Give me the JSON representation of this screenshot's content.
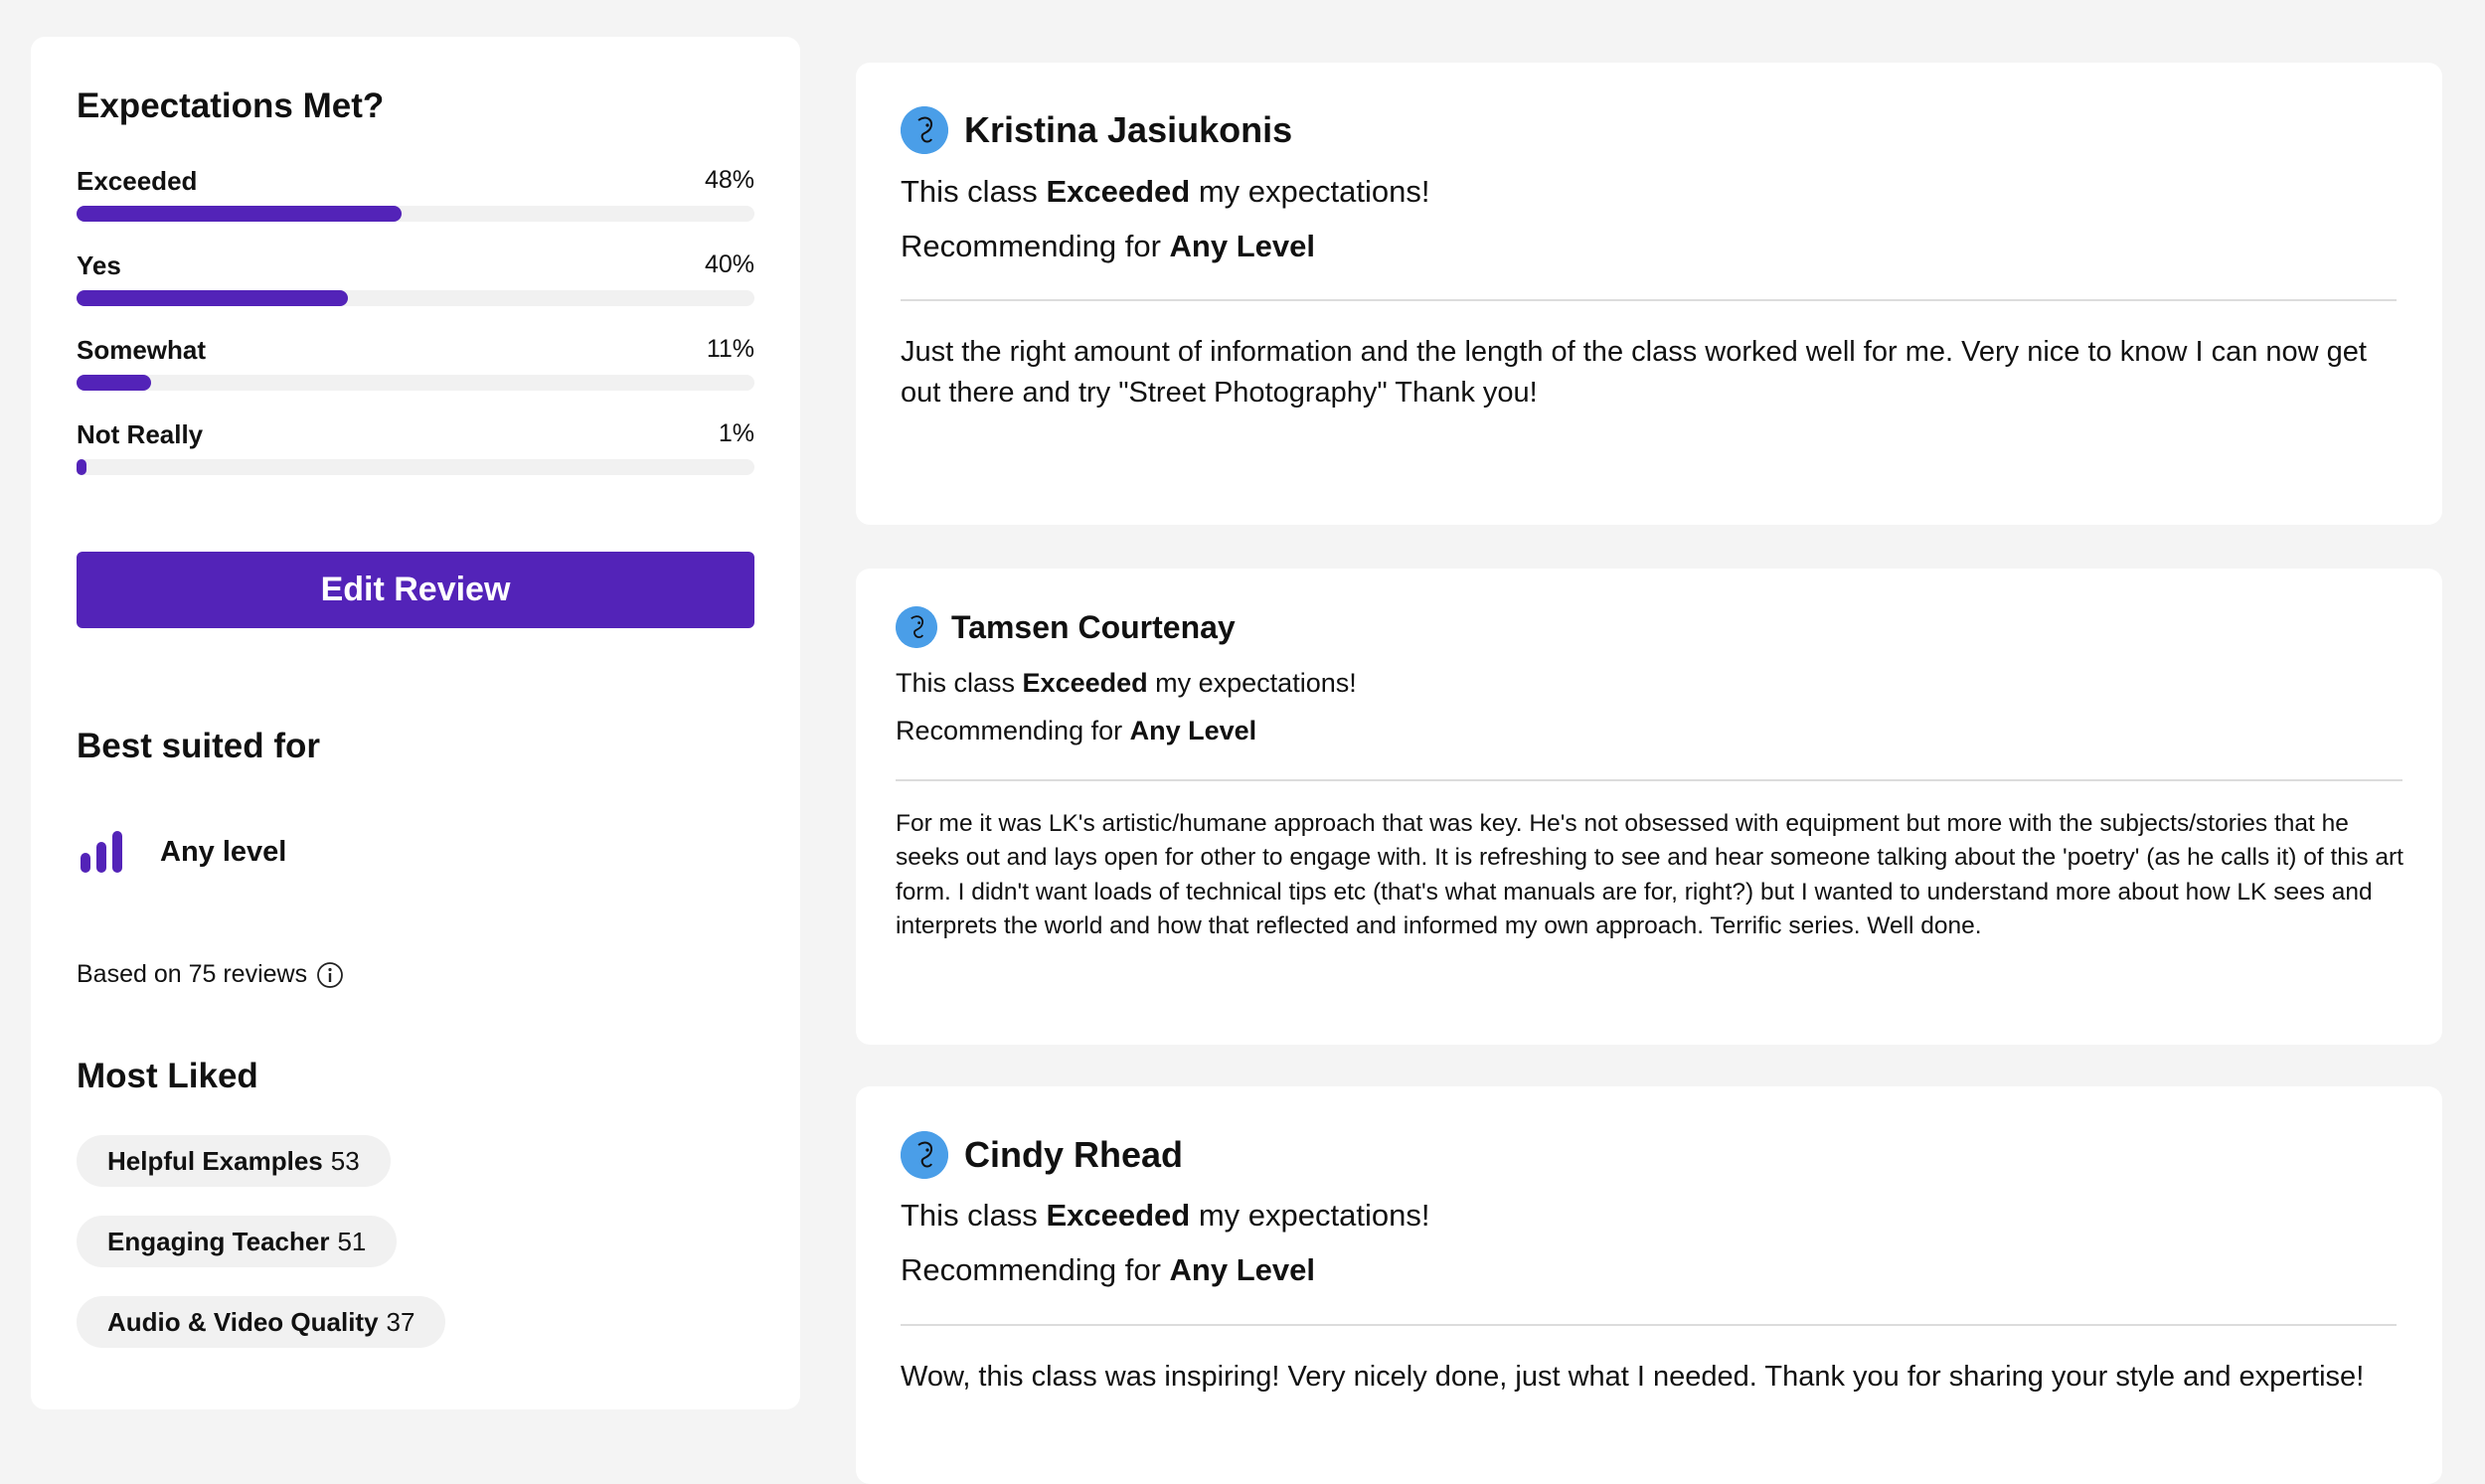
{
  "summary": {
    "expectations_title": "Expectations Met?",
    "bars": [
      {
        "label": "Exceeded",
        "pct_text": "48%",
        "fraction": 0.48
      },
      {
        "label": "Yes",
        "pct_text": "40%",
        "fraction": 0.4
      },
      {
        "label": "Somewhat",
        "pct_text": "11%",
        "fraction": 0.11
      },
      {
        "label": "Not Really",
        "pct_text": "1%",
        "fraction": 0.01
      }
    ],
    "edit_button_label": "Edit Review",
    "best_suited_title": "Best suited for",
    "level_label": "Any level",
    "based_on": "Based on 75 reviews",
    "most_liked_title": "Most Liked",
    "tags": [
      {
        "label": "Helpful Examples",
        "count": "53"
      },
      {
        "label": "Engaging Teacher",
        "count": "51"
      },
      {
        "label": "Audio & Video Quality",
        "count": "37"
      }
    ]
  },
  "reviews": [
    {
      "name": "Kristina Jasiukonis",
      "exp_prefix": "This class",
      "exp_value": "Exceeded",
      "exp_suffix": "my expectations!",
      "rec_prefix": "Recommending for",
      "rec_value": "Any Level",
      "text": "Just the right amount of information and the length of the class worked well for me. Very nice to know I can now get out there and try \"Street Photography\" Thank you!"
    },
    {
      "name": "Tamsen Courtenay",
      "exp_prefix": "This class",
      "exp_value": "Exceeded",
      "exp_suffix": "my expectations!",
      "rec_prefix": "Recommending for",
      "rec_value": "Any Level",
      "text": "For me it was LK's artistic/humane approach that was key. He's not obsessed with equipment but more with the subjects/stories that he seeks out and lays open for other to engage with. It is refreshing to see and hear someone talking about the 'poetry' (as he calls it) of this art form. I didn't want loads of technical tips etc (that's what manuals are for, right?) but I wanted to understand more about how LK sees and interprets the world and how that reflected and informed my own approach. Terrific series. Well done."
    },
    {
      "name": "Cindy Rhead",
      "exp_prefix": "This class",
      "exp_value": "Exceeded",
      "exp_suffix": "my expectations!",
      "rec_prefix": "Recommending for",
      "rec_value": "Any Level",
      "text": "Wow, this class was inspiring! Very nicely done, just what I needed. Thank you for sharing your style and expertise!"
    }
  ],
  "colors": {
    "accent": "#5323b8",
    "avatar": "#4a9ee8",
    "track": "#f1f1f1",
    "page_bg": "#f4f4f4"
  }
}
